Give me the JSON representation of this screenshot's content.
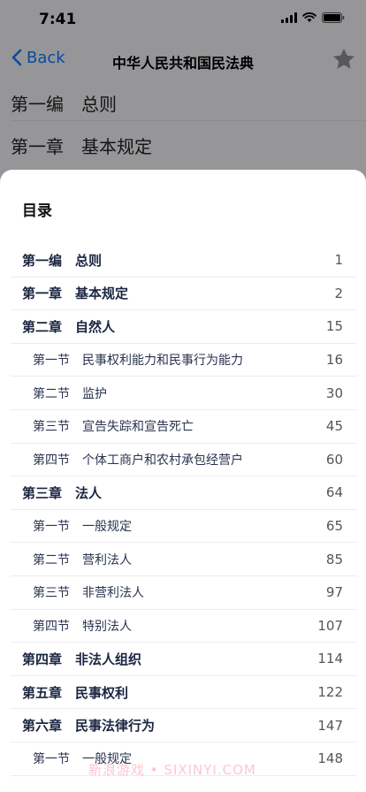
{
  "status_bar": {
    "time": "7:41"
  },
  "nav": {
    "back_label": "Back",
    "title": "中华人民共和国民法典"
  },
  "background_page": {
    "line1": "第一编　总则",
    "line2": "第一章　基本规定"
  },
  "sheet": {
    "title": "目录",
    "items": [
      {
        "label": "第一编　总则",
        "page": "1",
        "level": 1
      },
      {
        "label": "第一章　基本规定",
        "page": "2",
        "level": 1
      },
      {
        "label": "第二章　自然人",
        "page": "15",
        "level": 1
      },
      {
        "label": "第一节　民事权利能力和民事行为能力",
        "page": "16",
        "level": 2
      },
      {
        "label": "第二节　监护",
        "page": "30",
        "level": 2
      },
      {
        "label": "第三节　宣告失踪和宣告死亡",
        "page": "45",
        "level": 2
      },
      {
        "label": "第四节　个体工商户和农村承包经营户",
        "page": "60",
        "level": 2
      },
      {
        "label": "第三章　法人",
        "page": "64",
        "level": 1
      },
      {
        "label": "第一节　一般规定",
        "page": "65",
        "level": 2
      },
      {
        "label": "第二节　营利法人",
        "page": "85",
        "level": 2
      },
      {
        "label": "第三节　非营利法人",
        "page": "97",
        "level": 2
      },
      {
        "label": "第四节　特别法人",
        "page": "107",
        "level": 2
      },
      {
        "label": "第四章　非法人组织",
        "page": "114",
        "level": 1
      },
      {
        "label": "第五章　民事权利",
        "page": "122",
        "level": 1
      },
      {
        "label": "第六章　民事法律行为",
        "page": "147",
        "level": 1
      },
      {
        "label": "第一节　一般规定",
        "page": "148",
        "level": 2
      }
    ]
  },
  "watermark": "新浪游戏 • SIXINYI.COM",
  "colors": {
    "accent": "#0a7aff",
    "dim_overlay": "rgba(0,0,0,0.38)"
  },
  "icons": [
    "signal-icon",
    "wifi-icon",
    "battery-icon",
    "chevron-left-icon",
    "star-icon"
  ]
}
